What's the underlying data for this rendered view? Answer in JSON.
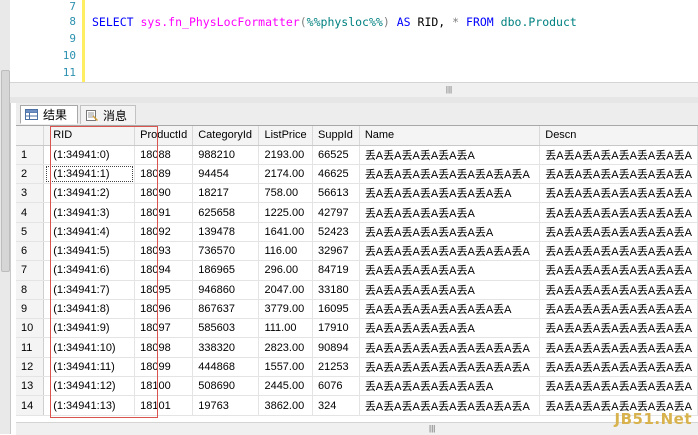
{
  "editor": {
    "line_numbers": [
      "7",
      "8",
      "9",
      "10",
      "11"
    ],
    "code": {
      "select": "SELECT",
      "fn": "sys.fn_PhysLocFormatter",
      "open": "(",
      "arg": "%%physloc%%",
      "close": ")",
      "as": "AS",
      "alias": "RID,",
      "star": "*",
      "from": "FROM",
      "table": "dbo.Product"
    }
  },
  "tabs": [
    {
      "label": "结果",
      "icon": "grid-icon",
      "active": true
    },
    {
      "label": "消息",
      "icon": "message-icon",
      "active": false
    }
  ],
  "grid": {
    "columns": [
      "",
      "RID",
      "ProductId",
      "CategoryId",
      "ListPrice",
      "SuppId",
      "Name",
      "Descn"
    ],
    "rows": [
      [
        "1",
        "(1:34941:0)",
        "18088",
        "988210",
        "2193.00",
        "66525",
        "丢A丢A丢A丢A丢A丢A",
        "丢A丢A丢A丢A丢A丢A丢A丢A"
      ],
      [
        "2",
        "(1:34941:1)",
        "18089",
        "94454",
        "2174.00",
        "46625",
        "丢A丢A丢A丢A丢A丢A丢A丢A丢A",
        "丢A丢A丢A丢A丢A丢A丢A丢A"
      ],
      [
        "3",
        "(1:34941:2)",
        "18090",
        "18217",
        "758.00",
        "56613",
        "丢A丢A丢A丢A丢A丢A丢A丢A",
        "丢A丢A丢A丢A丢A丢A丢A丢A"
      ],
      [
        "4",
        "(1:34941:3)",
        "18091",
        "625658",
        "1225.00",
        "42797",
        "丢A丢A丢A丢A丢A丢A",
        "丢A丢A丢A丢A丢A丢A丢A丢A"
      ],
      [
        "5",
        "(1:34941:4)",
        "18092",
        "139478",
        "1641.00",
        "52423",
        "丢A丢A丢A丢A丢A丢A丢A",
        "丢A丢A丢A丢A丢A丢A丢A丢A"
      ],
      [
        "6",
        "(1:34941:5)",
        "18093",
        "736570",
        "116.00",
        "32967",
        "丢A丢A丢A丢A丢A丢A丢A丢A丢A",
        "丢A丢A丢A丢A丢A丢A丢A丢A"
      ],
      [
        "7",
        "(1:34941:6)",
        "18094",
        "186965",
        "296.00",
        "84719",
        "丢A丢A丢A丢A丢A丢A",
        "丢A丢A丢A丢A丢A丢A丢A丢A"
      ],
      [
        "8",
        "(1:34941:7)",
        "18095",
        "946860",
        "2047.00",
        "33180",
        "丢A丢A丢A丢A丢A丢A",
        "丢A丢A丢A丢A丢A丢A丢A丢A"
      ],
      [
        "9",
        "(1:34941:8)",
        "18096",
        "867637",
        "3779.00",
        "16095",
        "丢A丢A丢A丢A丢A丢A丢A丢A",
        "丢A丢A丢A丢A丢A丢A丢A丢A"
      ],
      [
        "10",
        "(1:34941:9)",
        "18097",
        "585603",
        "111.00",
        "17910",
        "丢A丢A丢A丢A丢A丢A",
        "丢A丢A丢A丢A丢A丢A丢A丢A"
      ],
      [
        "11",
        "(1:34941:10)",
        "18098",
        "338320",
        "2823.00",
        "90894",
        "丢A丢A丢A丢A丢A丢A丢A丢A丢A",
        "丢A丢A丢A丢A丢A丢A丢A丢A"
      ],
      [
        "12",
        "(1:34941:11)",
        "18099",
        "444868",
        "1557.00",
        "21253",
        "丢A丢A丢A丢A丢A丢A丢A丢A丢A",
        "丢A丢A丢A丢A丢A丢A丢A丢A"
      ],
      [
        "13",
        "(1:34941:12)",
        "18100",
        "508690",
        "2445.00",
        "6076",
        "丢A丢A丢A丢A丢A丢A丢A",
        "丢A丢A丢A丢A丢A丢A丢A丢A"
      ],
      [
        "14",
        "(1:34941:13)",
        "18101",
        "19763",
        "3862.00",
        "324",
        "丢A丢A丢A丢A丢A丢A丢A丢A丢A",
        "丢A丢A丢A丢A丢A丢A丢A丢A"
      ]
    ]
  },
  "watermark": "JB51.Net",
  "colors": {
    "keyword": "#0000ff",
    "function": "#ff00ff",
    "string": "#ff0000",
    "highlight_box": "#d9534f",
    "line_number": "#2b91af"
  }
}
